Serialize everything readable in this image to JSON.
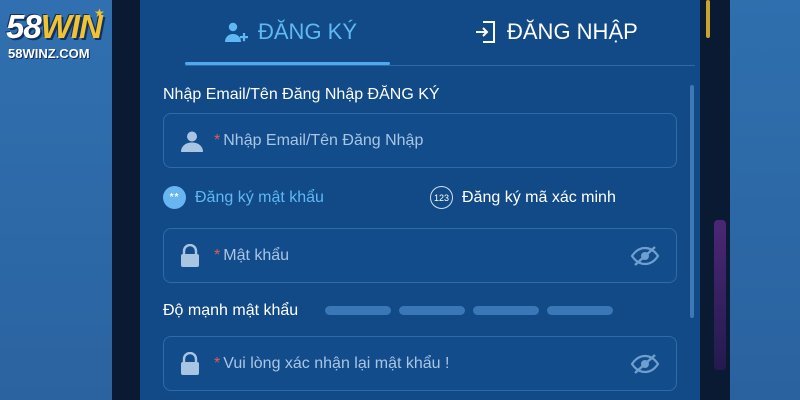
{
  "logo": {
    "brand_main": "58",
    "brand_accent": "WIN",
    "domain": "58WINZ.COM"
  },
  "tabs": [
    {
      "label": "ĐĂNG KÝ",
      "active": true,
      "icon": "user-add-icon"
    },
    {
      "label": "ĐĂNG NHẬP",
      "active": false,
      "icon": "login-door-icon"
    }
  ],
  "form": {
    "email_label": "Nhập Email/Tên Đăng Nhập ĐĂNG KÝ",
    "email_placeholder": "Nhập Email/Tên Đăng Nhập",
    "required_mark": "*",
    "methods": [
      {
        "label": "Đăng ký mật khẩu",
        "badge": "**",
        "active": true
      },
      {
        "label": "Đăng ký mã xác minh",
        "badge": "123",
        "active": false
      }
    ],
    "password_placeholder": "Mật khẩu",
    "strength_label": "Độ mạnh mật khẩu",
    "strength_level": 0,
    "strength_segments": 4,
    "confirm_placeholder": "Vui lòng xác nhận lại mật khẩu !"
  },
  "colors": {
    "panel": "#114a86",
    "accent": "#5fb8f4",
    "required": "#e05a5a",
    "brand_gold": "#f1c232"
  }
}
